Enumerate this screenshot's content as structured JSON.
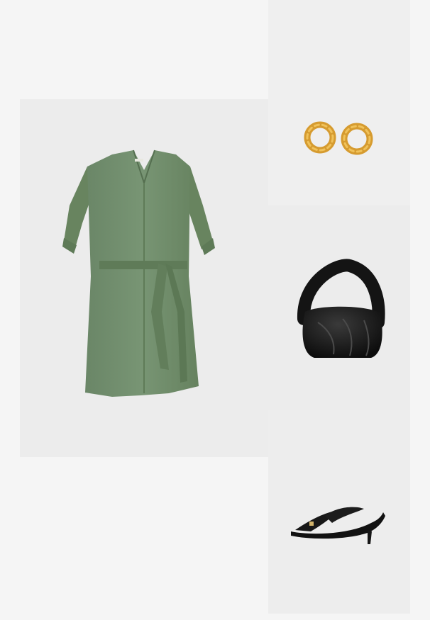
{
  "outfit": {
    "items": [
      {
        "id": "dress",
        "icon": "dress-image",
        "color": "#6f8b6b"
      },
      {
        "id": "earrings",
        "icon": "earrings-image",
        "color": "#d9a23a"
      },
      {
        "id": "handbag",
        "icon": "handbag-image",
        "color": "#111111"
      },
      {
        "id": "sandals",
        "icon": "sandals-image",
        "color": "#161616"
      }
    ]
  },
  "colors": {
    "page_background": "#f5f5f5",
    "tile_background": "#ececec"
  }
}
